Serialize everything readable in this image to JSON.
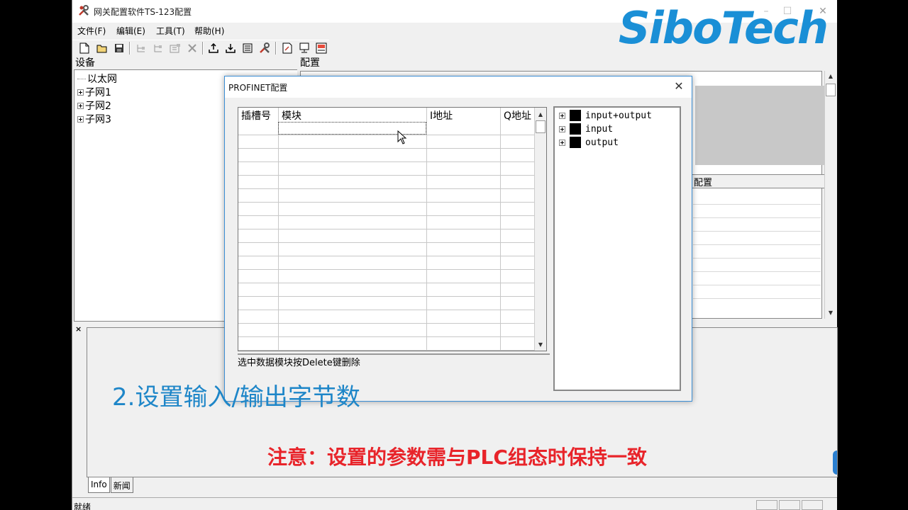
{
  "app": {
    "title": "网关配置软件TS-123配置",
    "brand": "SiboTech",
    "accent_color": "#1a8fd6"
  },
  "menu": [
    "文件(F)",
    "编辑(E)",
    "工具(T)",
    "帮助(H)"
  ],
  "toolbar_icons": [
    "new-file-icon",
    "open-folder-icon",
    "save-icon",
    "add-node-icon",
    "add-child-icon",
    "properties-icon",
    "delete-icon",
    "upload-icon",
    "download-icon",
    "config-icon",
    "tools-icon",
    "export-icon",
    "monitor-icon",
    "debug-icon"
  ],
  "devices_pane": {
    "header": "设备",
    "tree": [
      {
        "label": "以太网",
        "expandable": false
      },
      {
        "label": "子网1",
        "expandable": true
      },
      {
        "label": "子网2",
        "expandable": true
      },
      {
        "label": "子网3",
        "expandable": true
      }
    ]
  },
  "config_pane": {
    "header": "配置",
    "button_label": "配置"
  },
  "dialog": {
    "title": "PROFINET配置",
    "columns": [
      "插槽号",
      "模块",
      "I地址",
      "Q地址"
    ],
    "modules": [
      "input+output",
      "input",
      "output"
    ],
    "hint": "选中数据模块按Delete键删除"
  },
  "bottom_tabs": [
    "Info",
    "新闻"
  ],
  "status": "就绪",
  "annotations": {
    "step": "2.设置输入/输出字节数",
    "note": "注意：设置的参数需与PLC组态时保持一致",
    "step_color": "#1e86c8",
    "note_color": "#e8242a"
  }
}
